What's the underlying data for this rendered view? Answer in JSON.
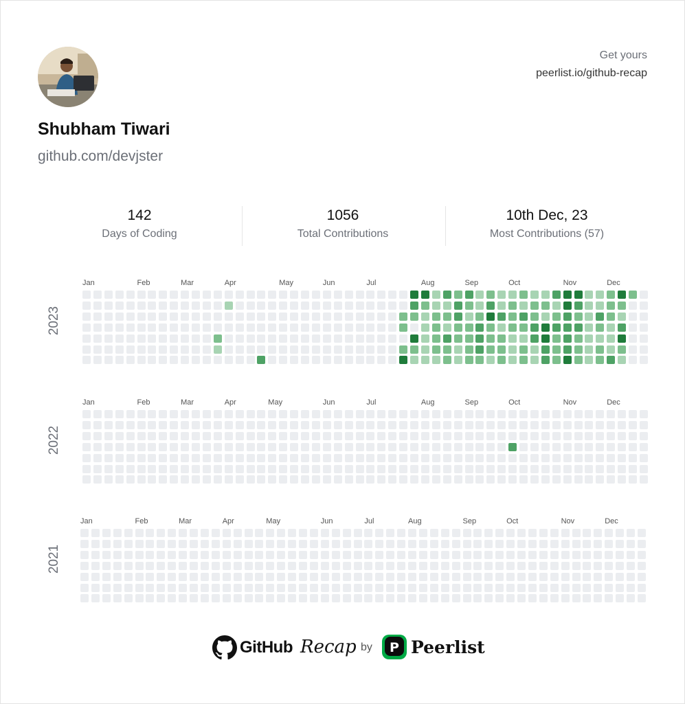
{
  "profile": {
    "name": "Shubham Tiwari",
    "handle": "github.com/devjster"
  },
  "cta": {
    "line1": "Get yours",
    "line2": "peerlist.io/github-recap"
  },
  "stats": [
    {
      "value": "142",
      "label": "Days of Coding"
    },
    {
      "value": "1056",
      "label": "Total Contributions"
    },
    {
      "value": "10th Dec, 23",
      "label": "Most Contributions (57)"
    }
  ],
  "colors": {
    "level0": "#ebedf0",
    "level1": "#a8d4b3",
    "level2": "#7dbf8d",
    "level3": "#4ea265",
    "level4": "#1f7c3b"
  },
  "calendars": [
    {
      "year": "2023",
      "months": [
        {
          "name": "Jan",
          "week": 0
        },
        {
          "name": "Feb",
          "week": 5
        },
        {
          "name": "Mar",
          "week": 9
        },
        {
          "name": "Apr",
          "week": 13
        },
        {
          "name": "May",
          "week": 18
        },
        {
          "name": "Jun",
          "week": 22
        },
        {
          "name": "Jul",
          "week": 26
        },
        {
          "name": "Aug",
          "week": 31
        },
        {
          "name": "Sep",
          "week": 35
        },
        {
          "name": "Oct",
          "week": 39
        },
        {
          "name": "Nov",
          "week": 44
        },
        {
          "name": "Dec",
          "week": 48
        }
      ],
      "cells": [
        [
          30,
          0,
          4
        ],
        [
          31,
          0,
          4
        ],
        [
          32,
          0,
          1
        ],
        [
          33,
          0,
          3
        ],
        [
          34,
          0,
          2
        ],
        [
          35,
          0,
          3
        ],
        [
          36,
          0,
          1
        ],
        [
          37,
          0,
          2
        ],
        [
          38,
          0,
          1
        ],
        [
          39,
          0,
          1
        ],
        [
          40,
          0,
          2
        ],
        [
          41,
          0,
          1
        ],
        [
          42,
          0,
          1
        ],
        [
          43,
          0,
          3
        ],
        [
          44,
          0,
          4
        ],
        [
          45,
          0,
          4
        ],
        [
          46,
          0,
          1
        ],
        [
          47,
          0,
          1
        ],
        [
          48,
          0,
          2
        ],
        [
          49,
          0,
          4
        ],
        [
          50,
          0,
          2
        ],
        [
          13,
          1,
          1
        ],
        [
          30,
          1,
          3
        ],
        [
          31,
          1,
          2
        ],
        [
          32,
          1,
          1
        ],
        [
          33,
          1,
          1
        ],
        [
          34,
          1,
          3
        ],
        [
          35,
          1,
          2
        ],
        [
          36,
          1,
          1
        ],
        [
          37,
          1,
          3
        ],
        [
          38,
          1,
          1
        ],
        [
          39,
          1,
          2
        ],
        [
          40,
          1,
          1
        ],
        [
          41,
          1,
          2
        ],
        [
          42,
          1,
          2
        ],
        [
          43,
          1,
          1
        ],
        [
          44,
          1,
          4
        ],
        [
          45,
          1,
          3
        ],
        [
          46,
          1,
          1
        ],
        [
          47,
          1,
          1
        ],
        [
          48,
          1,
          2
        ],
        [
          49,
          1,
          2
        ],
        [
          29,
          2,
          2
        ],
        [
          30,
          2,
          2
        ],
        [
          31,
          2,
          1
        ],
        [
          32,
          2,
          2
        ],
        [
          33,
          2,
          2
        ],
        [
          34,
          2,
          3
        ],
        [
          35,
          2,
          1
        ],
        [
          36,
          2,
          2
        ],
        [
          37,
          2,
          4
        ],
        [
          38,
          2,
          3
        ],
        [
          39,
          2,
          2
        ],
        [
          40,
          2,
          3
        ],
        [
          41,
          2,
          2
        ],
        [
          42,
          2,
          1
        ],
        [
          43,
          2,
          2
        ],
        [
          44,
          2,
          3
        ],
        [
          45,
          2,
          2
        ],
        [
          46,
          2,
          1
        ],
        [
          47,
          2,
          3
        ],
        [
          48,
          2,
          2
        ],
        [
          49,
          2,
          1
        ],
        [
          29,
          3,
          2
        ],
        [
          31,
          3,
          1
        ],
        [
          32,
          3,
          2
        ],
        [
          33,
          3,
          1
        ],
        [
          34,
          3,
          2
        ],
        [
          35,
          3,
          2
        ],
        [
          36,
          3,
          3
        ],
        [
          37,
          3,
          2
        ],
        [
          38,
          3,
          1
        ],
        [
          39,
          3,
          2
        ],
        [
          40,
          3,
          2
        ],
        [
          41,
          3,
          3
        ],
        [
          42,
          3,
          4
        ],
        [
          43,
          3,
          3
        ],
        [
          44,
          3,
          3
        ],
        [
          45,
          3,
          3
        ],
        [
          46,
          3,
          1
        ],
        [
          47,
          3,
          2
        ],
        [
          48,
          3,
          1
        ],
        [
          49,
          3,
          3
        ],
        [
          12,
          4,
          2
        ],
        [
          30,
          4,
          4
        ],
        [
          31,
          4,
          1
        ],
        [
          32,
          4,
          2
        ],
        [
          33,
          4,
          3
        ],
        [
          34,
          4,
          2
        ],
        [
          35,
          4,
          2
        ],
        [
          36,
          4,
          3
        ],
        [
          37,
          4,
          2
        ],
        [
          38,
          4,
          2
        ],
        [
          39,
          4,
          1
        ],
        [
          40,
          4,
          1
        ],
        [
          41,
          4,
          3
        ],
        [
          42,
          4,
          4
        ],
        [
          43,
          4,
          2
        ],
        [
          44,
          4,
          3
        ],
        [
          45,
          4,
          2
        ],
        [
          46,
          4,
          1
        ],
        [
          47,
          4,
          1
        ],
        [
          48,
          4,
          1
        ],
        [
          49,
          4,
          4
        ],
        [
          12,
          5,
          1
        ],
        [
          29,
          5,
          2
        ],
        [
          30,
          5,
          2
        ],
        [
          31,
          5,
          1
        ],
        [
          32,
          5,
          2
        ],
        [
          33,
          5,
          2
        ],
        [
          34,
          5,
          1
        ],
        [
          35,
          5,
          2
        ],
        [
          36,
          5,
          3
        ],
        [
          37,
          5,
          2
        ],
        [
          38,
          5,
          2
        ],
        [
          39,
          5,
          1
        ],
        [
          40,
          5,
          2
        ],
        [
          41,
          5,
          1
        ],
        [
          42,
          5,
          3
        ],
        [
          43,
          5,
          2
        ],
        [
          44,
          5,
          3
        ],
        [
          45,
          5,
          2
        ],
        [
          46,
          5,
          1
        ],
        [
          47,
          5,
          2
        ],
        [
          48,
          5,
          1
        ],
        [
          49,
          5,
          2
        ],
        [
          16,
          6,
          3
        ],
        [
          29,
          6,
          4
        ],
        [
          30,
          6,
          1
        ],
        [
          31,
          6,
          1
        ],
        [
          32,
          6,
          1
        ],
        [
          33,
          6,
          2
        ],
        [
          34,
          6,
          1
        ],
        [
          35,
          6,
          2
        ],
        [
          36,
          6,
          2
        ],
        [
          37,
          6,
          1
        ],
        [
          38,
          6,
          2
        ],
        [
          39,
          6,
          1
        ],
        [
          40,
          6,
          2
        ],
        [
          41,
          6,
          1
        ],
        [
          42,
          6,
          3
        ],
        [
          43,
          6,
          2
        ],
        [
          44,
          6,
          4
        ],
        [
          45,
          6,
          2
        ],
        [
          46,
          6,
          1
        ],
        [
          47,
          6,
          2
        ],
        [
          48,
          6,
          3
        ],
        [
          49,
          6,
          1
        ]
      ]
    },
    {
      "year": "2022",
      "months": [
        {
          "name": "Jan",
          "week": 0
        },
        {
          "name": "Feb",
          "week": 5
        },
        {
          "name": "Mar",
          "week": 9
        },
        {
          "name": "Apr",
          "week": 13
        },
        {
          "name": "May",
          "week": 17
        },
        {
          "name": "Jun",
          "week": 22
        },
        {
          "name": "Jul",
          "week": 26
        },
        {
          "name": "Aug",
          "week": 31
        },
        {
          "name": "Sep",
          "week": 35
        },
        {
          "name": "Oct",
          "week": 39
        },
        {
          "name": "Nov",
          "week": 44
        },
        {
          "name": "Dec",
          "week": 48
        }
      ],
      "cells": [
        [
          39,
          3,
          3
        ]
      ]
    },
    {
      "year": "2021",
      "months": [
        {
          "name": "Jan",
          "week": 0
        },
        {
          "name": "Feb",
          "week": 5
        },
        {
          "name": "Mar",
          "week": 9
        },
        {
          "name": "Apr",
          "week": 13
        },
        {
          "name": "May",
          "week": 17
        },
        {
          "name": "Jun",
          "week": 22
        },
        {
          "name": "Jul",
          "week": 26
        },
        {
          "name": "Aug",
          "week": 30
        },
        {
          "name": "Sep",
          "week": 35
        },
        {
          "name": "Oct",
          "week": 39
        },
        {
          "name": "Nov",
          "week": 44
        },
        {
          "name": "Dec",
          "week": 48
        }
      ],
      "cells": []
    }
  ],
  "footer": {
    "github": "GitHub",
    "recap": "Recap",
    "by": "by",
    "peerlist": "Peerlist",
    "peerlist_mark": "P"
  }
}
